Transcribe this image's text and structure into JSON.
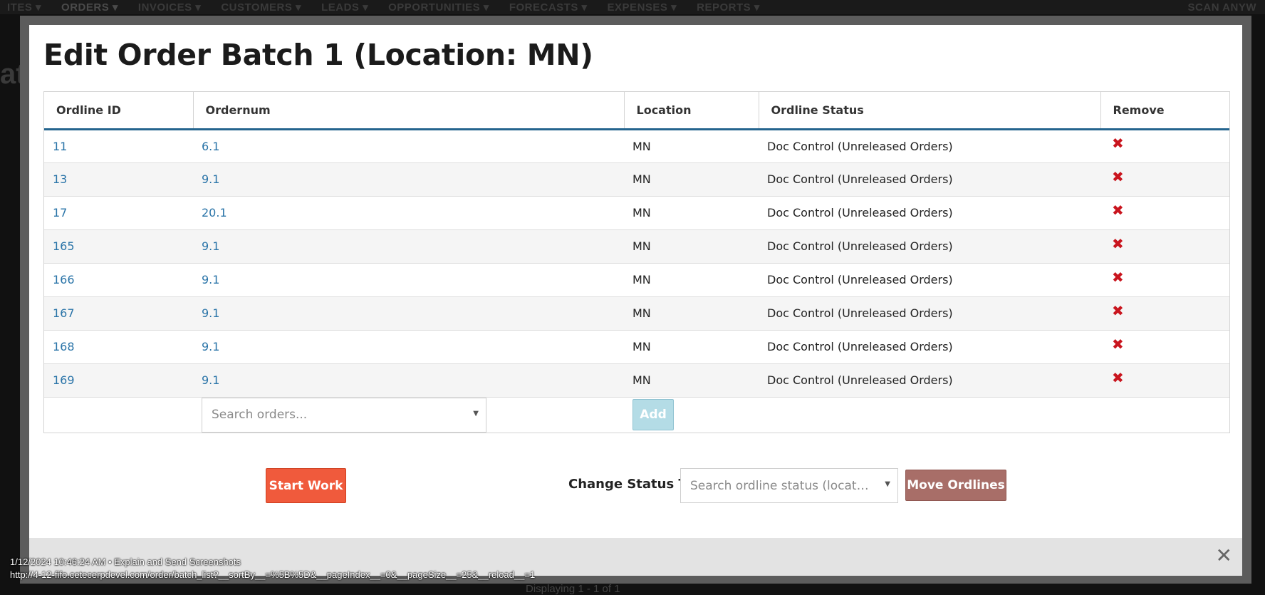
{
  "background": {
    "nav_items": [
      "ITES ▾",
      "ORDERS ▾",
      "INVOICES ▾",
      "CUSTOMERS ▾",
      "LEADS ▾",
      "OPPORTUNITIES ▾",
      "FORECASTS ▾",
      "EXPENSES ▾",
      "REPORTS ▾"
    ],
    "nav_right": "SCAN ANYW",
    "title_fragment": "at",
    "footer_fragment": "Displaying 1 - 1 of 1"
  },
  "modal": {
    "title": "Edit Order Batch 1 (Location: MN)",
    "columns": [
      "Ordline ID",
      "Ordernum",
      "Location",
      "Ordline Status",
      "Remove"
    ],
    "rows": [
      {
        "id": "11",
        "ordernum": "6.1",
        "location": "MN",
        "status": "Doc Control (Unreleased Orders)"
      },
      {
        "id": "13",
        "ordernum": "9.1",
        "location": "MN",
        "status": "Doc Control (Unreleased Orders)"
      },
      {
        "id": "17",
        "ordernum": "20.1",
        "location": "MN",
        "status": "Doc Control (Unreleased Orders)"
      },
      {
        "id": "165",
        "ordernum": "9.1",
        "location": "MN",
        "status": "Doc Control (Unreleased Orders)"
      },
      {
        "id": "166",
        "ordernum": "9.1",
        "location": "MN",
        "status": "Doc Control (Unreleased Orders)"
      },
      {
        "id": "167",
        "ordernum": "9.1",
        "location": "MN",
        "status": "Doc Control (Unreleased Orders)"
      },
      {
        "id": "168",
        "ordernum": "9.1",
        "location": "MN",
        "status": "Doc Control (Unreleased Orders)"
      },
      {
        "id": "169",
        "ordernum": "9.1",
        "location": "MN",
        "status": "Doc Control (Unreleased Orders)"
      }
    ],
    "remove_icon": "remove-x-icon",
    "search_orders_placeholder": "Search orders...",
    "add_label": "Add",
    "start_work_label": "Start Work",
    "change_status_label": "Change Status To",
    "status_placeholder": "Search ordline status (locat…",
    "move_ordlines_label": "Move Ordlines",
    "close_icon": "close-icon"
  },
  "screenshot_meta": {
    "timestamp_line": "1/12/2024 10:46:24 AM • Explain and Send Screenshots",
    "url_line": "http://4-12-fifo.cetecerpdevel.com/order/batch_list?__sortBy__=%5B%5D&__pageIndex__=0&__pageSize__=25&__reload__=1"
  },
  "colors": {
    "header_rule": "#24648e",
    "link": "#2a74a8",
    "start_work": "#f05a3c",
    "move_ordlines": "#a86e68",
    "add_disabled": "#b4dce6",
    "remove": "#c9151e"
  }
}
